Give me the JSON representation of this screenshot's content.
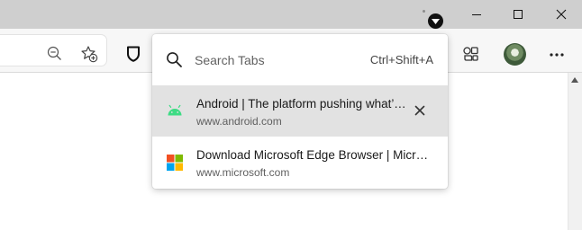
{
  "search": {
    "placeholder": "Search Tabs",
    "shortcut": "Ctrl+Shift+A"
  },
  "tabs": [
    {
      "title": "Android | The platform pushing what’s possible",
      "url": "www.android.com",
      "favicon": "android-icon",
      "selected": true
    },
    {
      "title": "Download Microsoft Edge Browser | Microsoft",
      "url": "www.microsoft.com",
      "favicon": "microsoft-icon",
      "selected": false
    }
  ],
  "colors": {
    "android_green": "#3ddc84",
    "titlebar": "#cfcfcf",
    "selected_row": "#e2e2e2"
  }
}
